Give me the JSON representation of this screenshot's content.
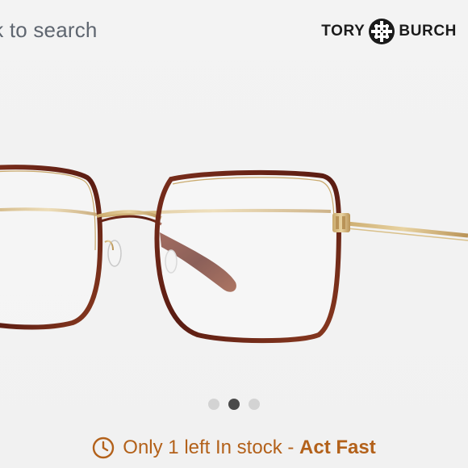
{
  "nav": {
    "back_label": "ck to search"
  },
  "brand": {
    "name_left": "TORY",
    "name_right": "BURCH",
    "logo_icon": "tory-burch-logo-icon"
  },
  "gallery": {
    "image_icon": "eyeglasses-product-photo",
    "current_index": 2,
    "total": 3
  },
  "stock": {
    "icon": "clock-icon",
    "message": "Only 1 left In stock - ",
    "emphasis": "Act Fast",
    "color": "#b3611a"
  }
}
